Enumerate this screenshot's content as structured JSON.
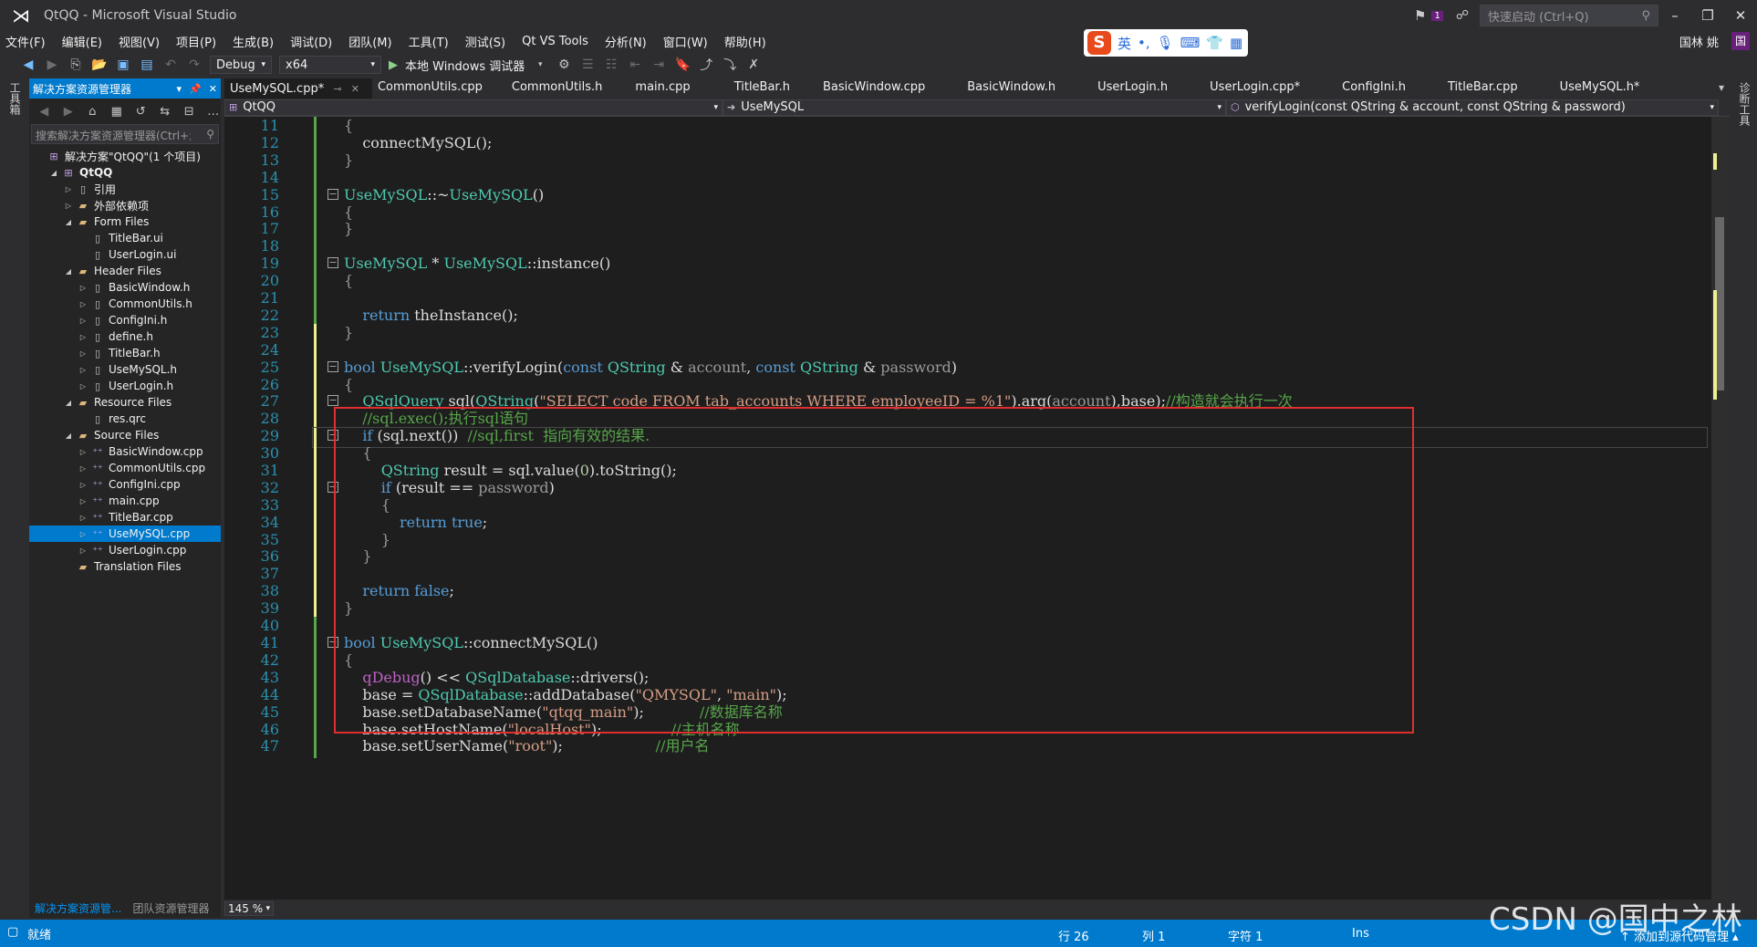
{
  "window": {
    "title": "QtQQ - Microsoft Visual Studio",
    "notification_count": "1",
    "quick_launch_placeholder": "快速启动 (Ctrl+Q)",
    "user_name": "国林 姚",
    "user_initials": "国"
  },
  "menu": [
    "文件(F)",
    "编辑(E)",
    "视图(V)",
    "项目(P)",
    "生成(B)",
    "调试(D)",
    "团队(M)",
    "工具(T)",
    "测试(S)",
    "Qt VS Tools",
    "分析(N)",
    "窗口(W)",
    "帮助(H)"
  ],
  "ime": {
    "logo": "S",
    "items": [
      "英",
      "•,",
      "🎙",
      "⌨",
      "👕",
      "▦"
    ]
  },
  "toolbar": {
    "configuration": "Debug",
    "platform": "x64",
    "debug_target": "本地 Windows 调试器"
  },
  "side_strips": {
    "left": "工具箱",
    "right": "诊断工具"
  },
  "solution_explorer": {
    "title": "解决方案资源管理器",
    "search_placeholder": "搜索解决方案资源管理器(Ctrl+;)",
    "tree": [
      {
        "label": "解决方案\"QtQQ\"(1 个项目)",
        "depth": 0,
        "arrow": "",
        "icon": "sol"
      },
      {
        "label": "QtQQ",
        "depth": 1,
        "arrow": "open",
        "icon": "sol",
        "bold": true
      },
      {
        "label": "引用",
        "depth": 2,
        "arrow": "closed",
        "icon": "file"
      },
      {
        "label": "外部依赖项",
        "depth": 2,
        "arrow": "closed",
        "icon": "folder"
      },
      {
        "label": "Form Files",
        "depth": 2,
        "arrow": "open",
        "icon": "folder"
      },
      {
        "label": "TitleBar.ui",
        "depth": 3,
        "arrow": "",
        "icon": "file"
      },
      {
        "label": "UserLogin.ui",
        "depth": 3,
        "arrow": "",
        "icon": "file"
      },
      {
        "label": "Header Files",
        "depth": 2,
        "arrow": "open",
        "icon": "folder"
      },
      {
        "label": "BasicWindow.h",
        "depth": 3,
        "arrow": "closed",
        "icon": "file"
      },
      {
        "label": "CommonUtils.h",
        "depth": 3,
        "arrow": "closed",
        "icon": "file"
      },
      {
        "label": "ConfigIni.h",
        "depth": 3,
        "arrow": "closed",
        "icon": "file"
      },
      {
        "label": "define.h",
        "depth": 3,
        "arrow": "closed",
        "icon": "file"
      },
      {
        "label": "TitleBar.h",
        "depth": 3,
        "arrow": "closed",
        "icon": "file"
      },
      {
        "label": "UseMySQL.h",
        "depth": 3,
        "arrow": "closed",
        "icon": "file"
      },
      {
        "label": "UserLogin.h",
        "depth": 3,
        "arrow": "closed",
        "icon": "file"
      },
      {
        "label": "Resource Files",
        "depth": 2,
        "arrow": "open",
        "icon": "folder"
      },
      {
        "label": "res.qrc",
        "depth": 3,
        "arrow": "",
        "icon": "file"
      },
      {
        "label": "Source Files",
        "depth": 2,
        "arrow": "open",
        "icon": "folder"
      },
      {
        "label": "BasicWindow.cpp",
        "depth": 3,
        "arrow": "closed",
        "icon": "cpp"
      },
      {
        "label": "CommonUtils.cpp",
        "depth": 3,
        "arrow": "closed",
        "icon": "cpp"
      },
      {
        "label": "ConfigIni.cpp",
        "depth": 3,
        "arrow": "closed",
        "icon": "cpp"
      },
      {
        "label": "main.cpp",
        "depth": 3,
        "arrow": "closed",
        "icon": "cpp"
      },
      {
        "label": "TitleBar.cpp",
        "depth": 3,
        "arrow": "closed",
        "icon": "cpp"
      },
      {
        "label": "UseMySQL.cpp",
        "depth": 3,
        "arrow": "closed",
        "icon": "cpp",
        "selected": true
      },
      {
        "label": "UserLogin.cpp",
        "depth": 3,
        "arrow": "closed",
        "icon": "cpp"
      },
      {
        "label": "Translation Files",
        "depth": 2,
        "arrow": "",
        "icon": "folder"
      }
    ],
    "bottom_tabs": [
      "解决方案资源管...",
      "团队资源管理器"
    ]
  },
  "tabs": [
    "UseMySQL.cpp*",
    "CommonUtils.cpp",
    "CommonUtils.h",
    "main.cpp",
    "TitleBar.h",
    "BasicWindow.cpp",
    "BasicWindow.h",
    "UserLogin.h",
    "UserLogin.cpp*",
    "ConfigIni.h",
    "TitleBar.cpp",
    "UseMySQL.h*"
  ],
  "navbar": {
    "project": "QtQQ",
    "scope": "UseMySQL",
    "member": "verifyLogin(const QString & account, const QString & password)"
  },
  "code_lines": [
    {
      "n": 11,
      "html": "<span class='p'>{</span>"
    },
    {
      "n": 12,
      "html": "    connectMySQL();"
    },
    {
      "n": 13,
      "html": "<span class='p'>}</span>"
    },
    {
      "n": 14,
      "html": ""
    },
    {
      "n": 15,
      "html": "<span class='t'>UseMySQL</span>::~<span class='t'>UseMySQL</span>()"
    },
    {
      "n": 16,
      "html": "<span class='p'>{</span>"
    },
    {
      "n": 17,
      "html": "<span class='p'>}</span>"
    },
    {
      "n": 18,
      "html": ""
    },
    {
      "n": 19,
      "html": "<span class='t'>UseMySQL</span> * <span class='t'>UseMySQL</span>::instance()"
    },
    {
      "n": 20,
      "html": "<span class='p'>{</span>"
    },
    {
      "n": 21,
      "html": ""
    },
    {
      "n": 22,
      "html": "    <span class='k'>return</span> theInstance();"
    },
    {
      "n": 23,
      "html": "<span class='p'>}</span>"
    },
    {
      "n": 24,
      "html": ""
    },
    {
      "n": 25,
      "html": "<span class='k'>bool</span> <span class='t'>UseMySQL</span>::verifyLogin(<span class='k'>const</span> <span class='t'>QString</span> &amp; <span class='p'>account</span>, <span class='k'>const</span> <span class='t'>QString</span> &amp; <span class='p'>password</span>)"
    },
    {
      "n": 26,
      "html": "<span class='p'>{</span>"
    },
    {
      "n": 27,
      "html": "    <span class='t'>QSqlQuery</span> sql(<span class='t'>QString</span>(<span class='s'>\"SELECT code FROM tab_accounts WHERE employeeID = %1\"</span>).arg(<span class='p'>account</span>),base);<span class='c'>//构造就会执行一次</span>"
    },
    {
      "n": 28,
      "html": "    <span class='c'>//sql.exec();执行sql语句</span>"
    },
    {
      "n": 29,
      "html": "    <span class='k'>if</span> (sql.next())  <span class='c'>//sql,first  指向有效的结果.</span>"
    },
    {
      "n": 30,
      "html": "    <span class='p'>{</span>"
    },
    {
      "n": 31,
      "html": "        <span class='t'>QString</span> result = sql.value(<span class='n'>0</span>).toString();"
    },
    {
      "n": 32,
      "html": "        <span class='k'>if</span> (result == <span class='p'>password</span>)"
    },
    {
      "n": 33,
      "html": "        <span class='p'>{</span>"
    },
    {
      "n": 34,
      "html": "            <span class='k'>return</span> <span class='k'>true</span>;"
    },
    {
      "n": 35,
      "html": "        <span class='p'>}</span>"
    },
    {
      "n": 36,
      "html": "    <span class='p'>}</span>"
    },
    {
      "n": 37,
      "html": ""
    },
    {
      "n": 38,
      "html": "    <span class='k'>return</span> <span class='k'>false</span>;"
    },
    {
      "n": 39,
      "html": "<span class='p'>}</span>"
    },
    {
      "n": 40,
      "html": ""
    },
    {
      "n": 41,
      "html": "<span class='k'>bool</span> <span class='t'>UseMySQL</span>::connectMySQL()"
    },
    {
      "n": 42,
      "html": "<span class='p'>{</span>"
    },
    {
      "n": 43,
      "html": "    <span class='m'>qDebug</span>() &lt;&lt; <span class='t'>QSqlDatabase</span>::drivers();"
    },
    {
      "n": 44,
      "html": "    base = <span class='t'>QSqlDatabase</span>::addDatabase(<span class='s'>\"QMYSQL\"</span>, <span class='s'>\"main\"</span>);"
    },
    {
      "n": 45,
      "html": "    base.setDatabaseName(<span class='s'>\"qtqq_main\"</span>);            <span class='c'>//数据库名称</span>"
    },
    {
      "n": 46,
      "html": "    base.setHostName(<span class='s'>\"localHost\"</span>);               <span class='c'>//主机名称</span>"
    },
    {
      "n": 47,
      "html": "    base.setUserName(<span class='s'>\"root\"</span>);                    <span class='c'>//用户名</span>"
    }
  ],
  "editor": {
    "zoom": "145 %"
  },
  "status": {
    "text": "就绪",
    "line": "行 26",
    "col": "列 1",
    "char": "字符 1",
    "mode": "Ins",
    "source_control": "↑ 添加到源代码管理 ▴"
  },
  "watermark": "CSDN @国中之林"
}
